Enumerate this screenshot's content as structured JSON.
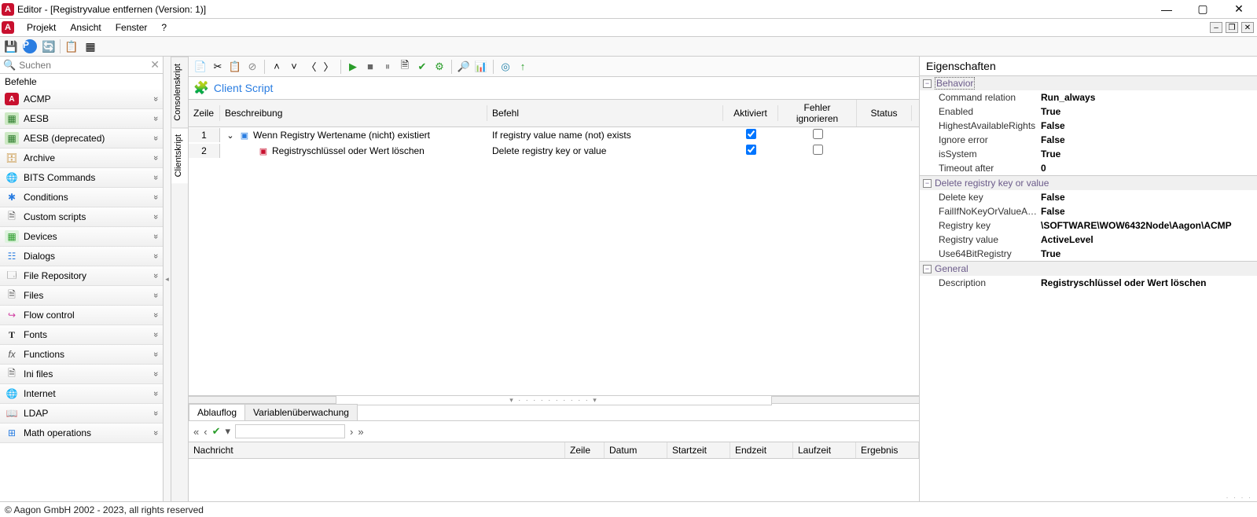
{
  "window": {
    "app_letter": "A",
    "title": "Editor - [Registryvalue entfernen (Version: 1)]"
  },
  "menu": {
    "items": [
      "Projekt",
      "Ansicht",
      "Fenster",
      "?"
    ]
  },
  "search": {
    "placeholder": "Suchen"
  },
  "left": {
    "header": "Befehle",
    "items": [
      {
        "label": "ACMP",
        "icon": "A",
        "cls": "acmp"
      },
      {
        "label": "AESB",
        "icon": "▦",
        "cls": "ic-aesb"
      },
      {
        "label": "AESB (deprecated)",
        "icon": "▦",
        "cls": "ic-aesb"
      },
      {
        "label": "Archive",
        "icon": "🗄",
        "cls": "ic-archive"
      },
      {
        "label": "BITS Commands",
        "icon": "🌐",
        "cls": "ic-globe"
      },
      {
        "label": "Conditions",
        "icon": "✱",
        "cls": "ic-cond"
      },
      {
        "label": "Custom scripts",
        "icon": "🗎",
        "cls": "ic-script"
      },
      {
        "label": "Devices",
        "icon": "▦",
        "cls": "ic-device"
      },
      {
        "label": "Dialogs",
        "icon": "☷",
        "cls": "ic-dialog"
      },
      {
        "label": "File Repository",
        "icon": "🗔",
        "cls": "ic-repo"
      },
      {
        "label": "Files",
        "icon": "🗎",
        "cls": "ic-files"
      },
      {
        "label": "Flow control",
        "icon": "↪",
        "cls": "ic-flow"
      },
      {
        "label": "Fonts",
        "icon": "T",
        "cls": "ic-font"
      },
      {
        "label": "Functions",
        "icon": "fx",
        "cls": "ic-fx"
      },
      {
        "label": "Ini files",
        "icon": "🗎",
        "cls": "ic-ini"
      },
      {
        "label": "Internet",
        "icon": "🌐",
        "cls": "ic-net"
      },
      {
        "label": "LDAP",
        "icon": "📖",
        "cls": "ic-ldap"
      },
      {
        "label": "Math operations",
        "icon": "⊞",
        "cls": "ic-math"
      }
    ]
  },
  "vtabs": {
    "console": "Consolenskript",
    "client": "Clientskript"
  },
  "script": {
    "title": "Client Script",
    "columns": {
      "zeile": "Zeile",
      "beschreibung": "Beschreibung",
      "befehl": "Befehl",
      "aktiviert": "Aktiviert",
      "fehler": "Fehler ignorieren",
      "status": "Status"
    },
    "rows": [
      {
        "n": "1",
        "desc": "Wenn Registry Wertename (nicht) existiert",
        "cmd": "If registry value name (not) exists",
        "aktiv": true,
        "fehler": false,
        "indent": 0,
        "expander": true
      },
      {
        "n": "2",
        "desc": "Registryschlüssel oder Wert löschen",
        "cmd": "Delete registry key or value",
        "aktiv": true,
        "fehler": false,
        "indent": 1,
        "expander": false
      }
    ]
  },
  "bottom": {
    "tabs": {
      "log": "Ablauflog",
      "vars": "Variablenüberwachung"
    },
    "columns": {
      "msg": "Nachricht",
      "zeile": "Zeile",
      "datum": "Datum",
      "start": "Startzeit",
      "end": "Endzeit",
      "dur": "Laufzeit",
      "res": "Ergebnis"
    }
  },
  "props": {
    "title": "Eigenschaften",
    "groups": [
      {
        "name": "Behavior",
        "rows": [
          {
            "k": "Command relation",
            "v": "Run_always"
          },
          {
            "k": "Enabled",
            "v": "True"
          },
          {
            "k": "HighestAvailableRights",
            "v": "False"
          },
          {
            "k": "Ignore error",
            "v": "False"
          },
          {
            "k": "isSystem",
            "v": "True"
          },
          {
            "k": "Timeout after",
            "v": "0"
          }
        ]
      },
      {
        "name": "Delete registry key or value",
        "rows": [
          {
            "k": "Delete key",
            "v": "False"
          },
          {
            "k": "FailIfNoKeyOrValueAvailable",
            "v": "False"
          },
          {
            "k": "Registry key",
            "v": "\\SOFTWARE\\WOW6432Node\\Aagon\\ACMP"
          },
          {
            "k": "Registry value",
            "v": "ActiveLevel"
          },
          {
            "k": "Use64BitRegistry",
            "v": "True"
          }
        ]
      },
      {
        "name": "General",
        "rows": [
          {
            "k": "Description",
            "v": "Registryschlüssel oder Wert löschen"
          }
        ]
      }
    ]
  },
  "status": {
    "copyright": "© Aagon GmbH 2002 - 2023, all rights reserved"
  }
}
